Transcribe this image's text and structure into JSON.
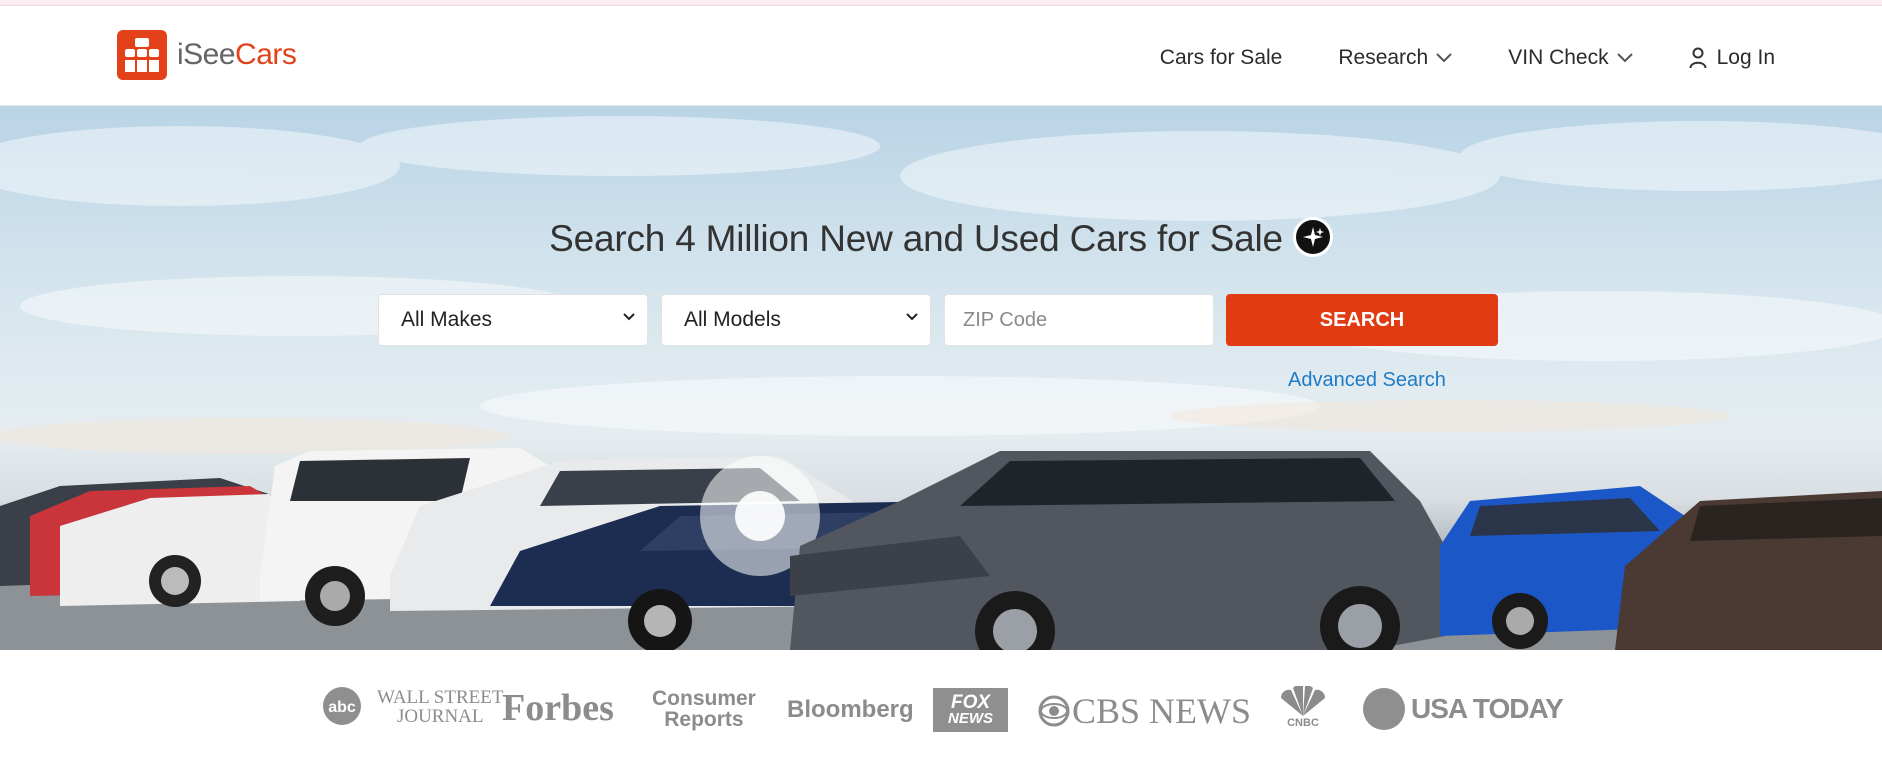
{
  "brand": {
    "name_part1": "iSee",
    "name_part2": "Cars",
    "accent_color": "#e2411a"
  },
  "nav": {
    "items": [
      {
        "label": "Cars for Sale",
        "icon": null
      },
      {
        "label": "Research",
        "icon": "chevron-down-icon"
      },
      {
        "label": "VIN Check",
        "icon": "chevron-down-icon"
      },
      {
        "label": "Log In",
        "icon": "user-icon"
      }
    ]
  },
  "hero": {
    "title": "Search 4 Million New and Used Cars for Sale",
    "ai_icon": "sparkle-chat-icon",
    "makes_select": {
      "value": "All Makes",
      "options": [
        "All Makes"
      ]
    },
    "models_select": {
      "value": "All Models",
      "options": [
        "All Models"
      ]
    },
    "zip": {
      "placeholder": "ZIP Code",
      "value": ""
    },
    "search_label": "SEARCH",
    "search_color": "#e03b13",
    "advanced_search_label": "Advanced Search",
    "link_color": "#1e7bc6"
  },
  "press": {
    "logos": [
      {
        "name": "abc",
        "text": "abc"
      },
      {
        "name": "wall-street-journal",
        "line1": "WALL STREET",
        "line2": "JOURNAL"
      },
      {
        "name": "forbes",
        "text": "Forbes"
      },
      {
        "name": "consumer-reports",
        "line1": "Consumer",
        "line2": "Reports"
      },
      {
        "name": "bloomberg",
        "text": "Bloomberg"
      },
      {
        "name": "fox-news",
        "line1": "FOX",
        "line2": "NEWS"
      },
      {
        "name": "cbs-news",
        "text": "CBS NEWS"
      },
      {
        "name": "cnbc",
        "text": "CNBC"
      },
      {
        "name": "usa-today",
        "text": "USA TODAY"
      }
    ]
  }
}
